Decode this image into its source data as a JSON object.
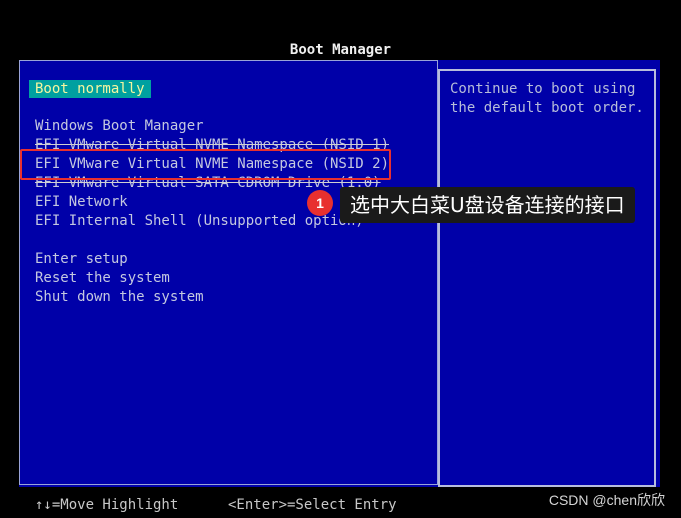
{
  "header": {
    "title": "Boot Manager"
  },
  "menu": {
    "selected": "Boot normally",
    "items": [
      "Windows Boot Manager",
      "EFI VMware Virtual NVME Namespace (NSID 1)",
      "EFI VMware Virtual NVME Namespace (NSID 2)",
      "EFI VMware Virtual SATA CDROM Drive (1.0)",
      "EFI Network",
      "EFI Internal Shell (Unsupported option)"
    ],
    "actions": [
      "Enter setup",
      "Reset the system",
      "Shut down the system"
    ]
  },
  "help": {
    "text": "Continue to boot using\nthe default boot order."
  },
  "annotation": {
    "badge": "1",
    "label": "选中大白菜U盘设备连接的接口",
    "color": "#e8302f"
  },
  "footer": {
    "move": "↑↓=Move Highlight",
    "select": "<Enter>=Select Entry"
  },
  "watermark": "CSDN @chen欣欣",
  "colors": {
    "background": "#0000a8",
    "selected_bg": "#00a0a0",
    "selected_text": "#f6f6a0"
  }
}
